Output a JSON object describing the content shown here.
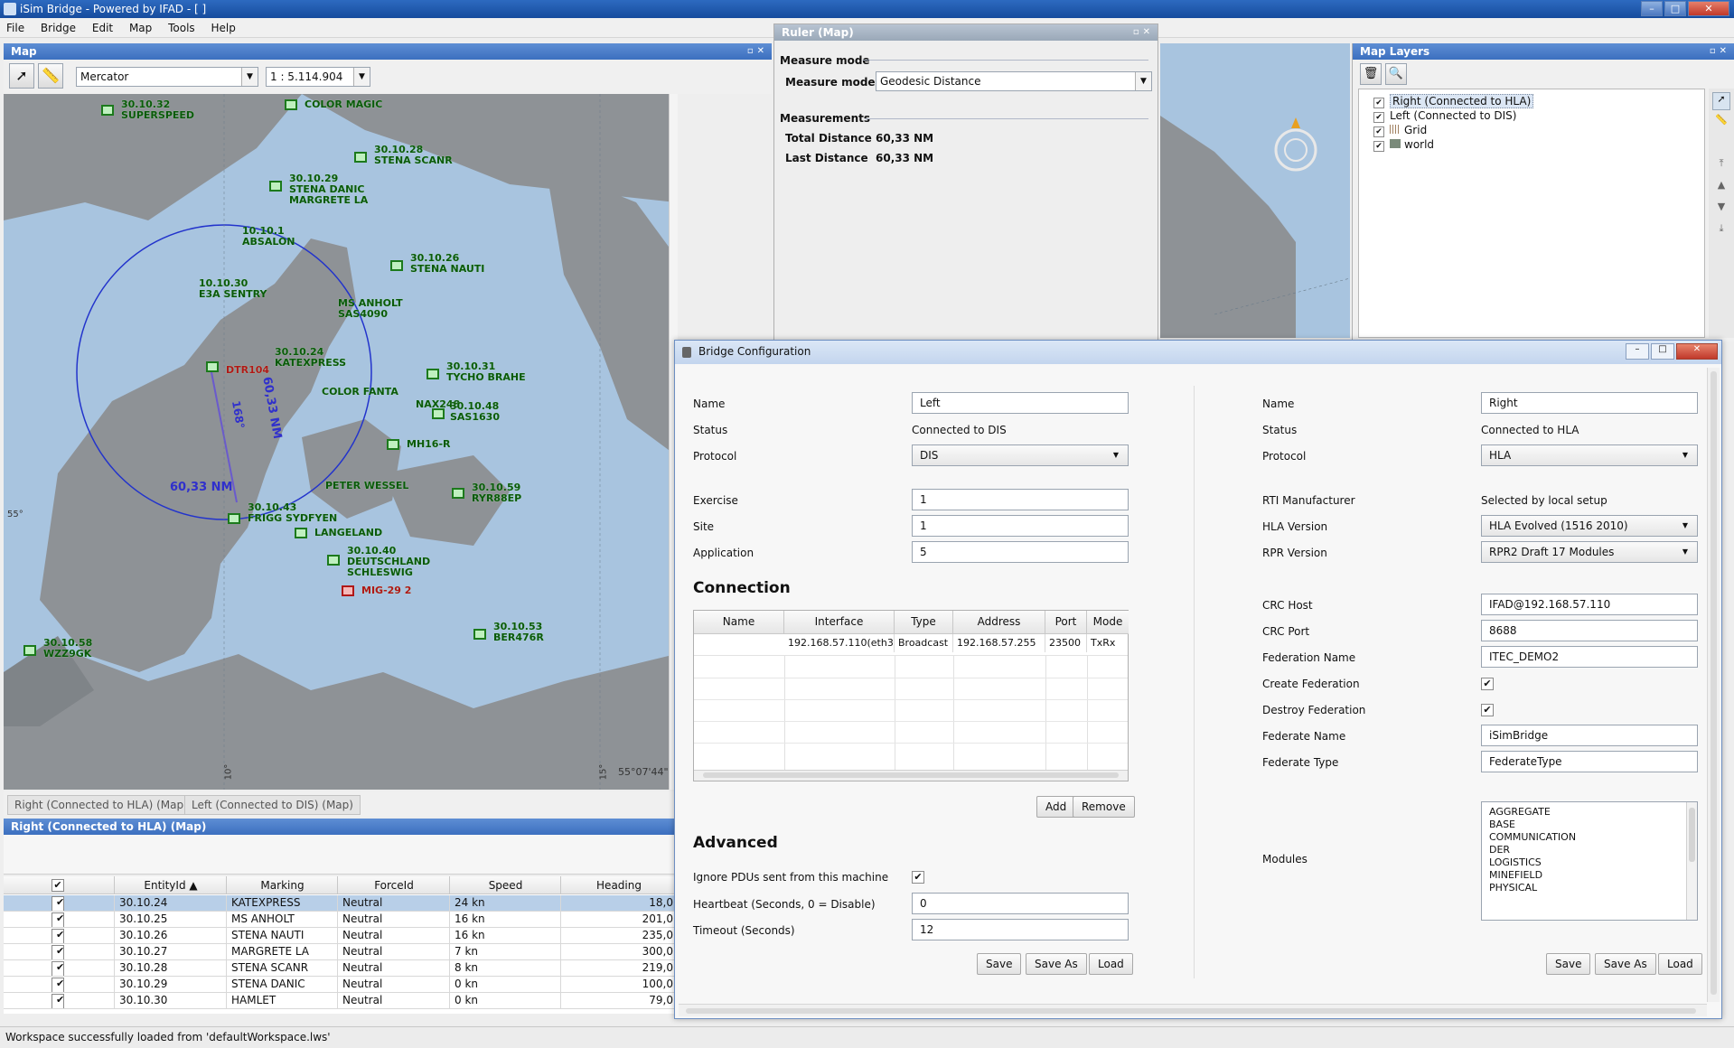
{
  "window": {
    "title": "iSim Bridge - Powered by IFAD - [ ]"
  },
  "menu": [
    "File",
    "Bridge",
    "Edit",
    "Map",
    "Tools",
    "Help"
  ],
  "map_panel": {
    "title": "Map",
    "projection": "Mercator",
    "scale": "1 : 5.114.904",
    "ruler_distance": "60,33 NM",
    "ruler_bearing": "168°",
    "coord_lat": "55°07'44\"",
    "coord_s": "55°",
    "tick_lon1": "10°",
    "tick_lon2": "15°",
    "labels": [
      {
        "id": "30.10.32",
        "name": "SUPERSPEED"
      },
      {
        "id": "",
        "name": "COLOR MAGIC"
      },
      {
        "id": "30.10.28",
        "name": "STENA SCANR"
      },
      {
        "id": "30.10.29",
        "name": "STENA DANIC"
      },
      {
        "id": "",
        "name": "MARGRETE LA"
      },
      {
        "id": "10.10.1",
        "name": "ABSALON"
      },
      {
        "id": "10.10.30",
        "name": "E3A SENTRY"
      },
      {
        "id": "30.10.26",
        "name": "STENA NAUTI"
      },
      {
        "id": "30.10.25",
        "name": "MS ANHOLT"
      },
      {
        "id": "",
        "name": "SAS4090"
      },
      {
        "id": "30.10.24",
        "name": "KATEXPRESS"
      },
      {
        "id": "",
        "name": "DTR104"
      },
      {
        "id": "30.10.31",
        "name": "TYCHO BRAHE"
      },
      {
        "id": "",
        "name": "COLOR FANTA"
      },
      {
        "id": "",
        "name": "NAX248"
      },
      {
        "id": "30.10.48",
        "name": "SAS1630"
      },
      {
        "id": "",
        "name": "MH16-R"
      },
      {
        "id": "",
        "name": "PETER WESSEL"
      },
      {
        "id": "30.10.59",
        "name": "RYR88EP"
      },
      {
        "id": "30.10.43",
        "name": "FRIGG SYDFYEN"
      },
      {
        "id": "",
        "name": "LANGELAND"
      },
      {
        "id": "30.10.40",
        "name": "DEUTSCHLAND"
      },
      {
        "id": "",
        "name": "SCHLESWIG"
      },
      {
        "id": "",
        "name": "MIG-29 2"
      },
      {
        "id": "30.10.53",
        "name": "BER476R"
      },
      {
        "id": "30.10.58",
        "name": "WZZ9GK"
      }
    ],
    "tabs": [
      "Right (Connected to HLA) (Map)",
      "Left (Connected to DIS) (Map)"
    ]
  },
  "ruler": {
    "title": "Ruler (Map)",
    "section_mode": "Measure mode",
    "mode_label": "Measure mode",
    "mode_value": "Geodesic Distance",
    "section_measure": "Measurements",
    "total_label": "Total Distance",
    "total_value": "60,33 NM",
    "last_label": "Last Distance",
    "last_value": "60,33 NM"
  },
  "layers": {
    "title": "Map Layers",
    "items": [
      {
        "label": "Right (Connected to HLA)",
        "checked": true,
        "selected": true
      },
      {
        "label": "Left (Connected to DIS)",
        "checked": true
      },
      {
        "label": "Grid",
        "checked": true
      },
      {
        "label": "world",
        "checked": true
      }
    ]
  },
  "entity_table": {
    "title": "Right (Connected to HLA) (Map)",
    "columns": [
      "EntityId ▲",
      "Marking",
      "ForceId",
      "Speed",
      "Heading"
    ],
    "rows": [
      [
        "30.10.24",
        "KATEXPRESS",
        "Neutral",
        "24 kn",
        "18,0"
      ],
      [
        "30.10.25",
        "MS ANHOLT",
        "Neutral",
        "16 kn",
        "201,0"
      ],
      [
        "30.10.26",
        "STENA NAUTI",
        "Neutral",
        "16 kn",
        "235,0"
      ],
      [
        "30.10.27",
        "MARGRETE LA",
        "Neutral",
        "7 kn",
        "300,0"
      ],
      [
        "30.10.28",
        "STENA SCANR",
        "Neutral",
        "8 kn",
        "219,0"
      ],
      [
        "30.10.29",
        "STENA DANIC",
        "Neutral",
        "0 kn",
        "100,0"
      ],
      [
        "30.10.30",
        "HAMLET",
        "Neutral",
        "0 kn",
        "79,0"
      ]
    ]
  },
  "status": "Workspace successfully loaded from 'defaultWorkspace.lws'",
  "bridge": {
    "title": "Bridge Configuration",
    "left": {
      "name_label": "Name",
      "name_value": "Left",
      "status_label": "Status",
      "status_value": "Connected to DIS",
      "protocol_label": "Protocol",
      "protocol_value": "DIS",
      "exercise_label": "Exercise",
      "exercise_value": "1",
      "site_label": "Site",
      "site_value": "1",
      "application_label": "Application",
      "application_value": "5",
      "connection_title": "Connection",
      "conn_columns": [
        "Name",
        "Interface",
        "Type",
        "Address",
        "Port",
        "Mode"
      ],
      "conn_row": [
        "",
        "192.168.57.110(eth3)",
        "Broadcast",
        "192.168.57.255",
        "23500",
        "TxRx"
      ],
      "add": "Add",
      "remove": "Remove",
      "advanced_title": "Advanced",
      "ignore_label": "Ignore PDUs sent from this machine",
      "heartbeat_label": "Heartbeat (Seconds, 0 = Disable)",
      "heartbeat_value": "0",
      "timeout_label": "Timeout (Seconds)",
      "timeout_value": "12",
      "save": "Save",
      "save_as": "Save As",
      "load": "Load"
    },
    "right": {
      "name_label": "Name",
      "name_value": "Right",
      "status_label": "Status",
      "status_value": "Connected to HLA",
      "protocol_label": "Protocol",
      "protocol_value": "HLA",
      "rti_label": "RTI Manufacturer",
      "rti_value": "Selected by local setup",
      "hla_label": "HLA Version",
      "hla_value": "HLA Evolved (1516 2010)",
      "rpr_label": "RPR Version",
      "rpr_value": "RPR2 Draft 17 Modules",
      "crc_host_label": "CRC Host",
      "crc_host_value": "IFAD@192.168.57.110",
      "crc_port_label": "CRC Port",
      "crc_port_value": "8688",
      "fed_name_label": "Federation Name",
      "fed_name_value": "ITEC_DEMO2",
      "create_fed_label": "Create Federation",
      "destroy_fed_label": "Destroy Federation",
      "federate_name_label": "Federate Name",
      "federate_name_value": "iSimBridge",
      "federate_type_label": "Federate Type",
      "federate_type_value": "FederateType",
      "modules_label": "Modules",
      "modules": [
        "AGGREGATE",
        "BASE",
        "COMMUNICATION",
        "DER",
        "LOGISTICS",
        "MINEFIELD",
        "PHYSICAL"
      ],
      "save": "Save",
      "save_as": "Save As",
      "load": "Load"
    }
  },
  "colors": {
    "title_blue": "#1f5bb0",
    "panel_blue": "#4a7fc9",
    "land": "#8e9296",
    "sea": "#a8c4df",
    "unit_green": "#1c7a1c"
  }
}
